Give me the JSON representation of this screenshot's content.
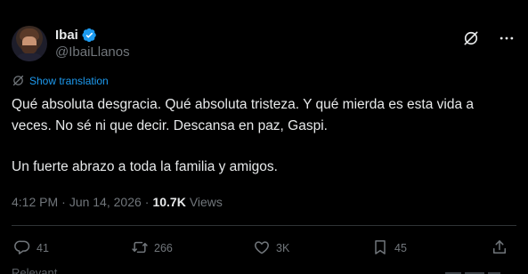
{
  "author": {
    "name": "Ibai",
    "handle": "@IbaiLlanos",
    "verified": true
  },
  "translate": {
    "label": "Show translation"
  },
  "tweet": {
    "paragraph1": "Qué absoluta desgracia. Qué absoluta tristeza. Y qué mierda es esta vida a veces. No sé ni que decir. Descansa en paz, Gaspi.",
    "paragraph2": "Un fuerte abrazo a toda la familia y amigos."
  },
  "meta": {
    "time": "4:12 PM",
    "separator": "·",
    "date": "Jun 14, 2026",
    "views_count": "10.7K",
    "views_label": "Views"
  },
  "actions": {
    "replies": "41",
    "reposts": "266",
    "likes": "3K",
    "bookmarks": "45"
  },
  "footer": {
    "partial_text": "Relevant"
  },
  "colors": {
    "background": "#000000",
    "text": "#e7e9ea",
    "muted": "#71767b",
    "accent": "#1d9bf0",
    "divider": "#2f3336"
  },
  "icons": {
    "verified": "verified-badge-icon",
    "grok": "grok-icon",
    "more": "more-icon",
    "translate": "translate-icon",
    "reply": "reply-icon",
    "repost": "repost-icon",
    "like": "like-icon",
    "bookmark": "bookmark-icon",
    "share": "share-icon"
  }
}
